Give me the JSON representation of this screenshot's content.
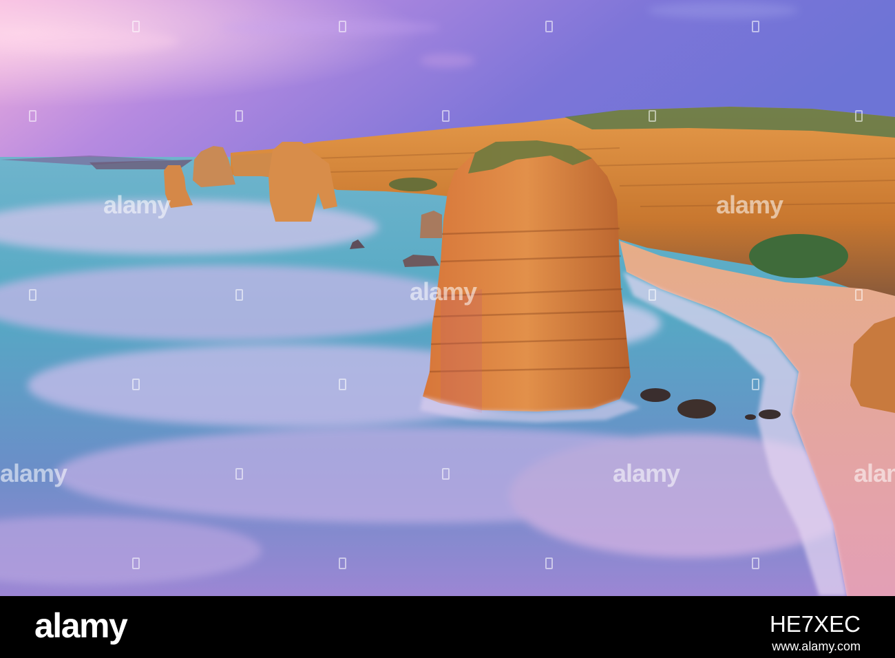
{
  "photo": {
    "subject": "coastal-sea-stacks-at-sunset",
    "colors": {
      "sky_pink": "#f2a6d9",
      "sky_purple": "#7f72d8",
      "cliff_orange": "#d88a3c",
      "water_teal": "#3fa3c0",
      "water_mist": "#c8b3e6",
      "sand": "#e3a57e"
    }
  },
  "watermarks": [
    {
      "text": "alamy"
    },
    {
      "text": "alamy"
    },
    {
      "text": "alamy"
    },
    {
      "text": "alamy"
    },
    {
      "text": "alamy"
    },
    {
      "text": "alamy"
    },
    {
      "text": "alamy"
    },
    {
      "text": "alamy"
    }
  ],
  "footer": {
    "logo": "alamy",
    "image_code": "HE7XEC",
    "url": "www.alamy.com"
  }
}
